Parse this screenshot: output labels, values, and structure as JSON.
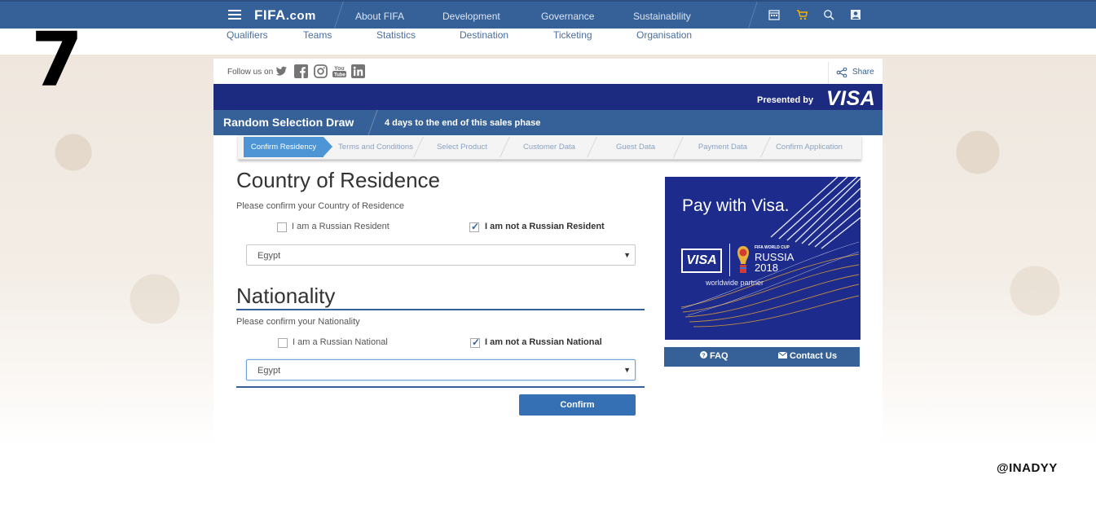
{
  "header": {
    "logo_main": "FIFA",
    "logo_suffix": ".com",
    "nav": [
      "About FIFA",
      "Development",
      "Governance",
      "Sustainability"
    ],
    "icons": [
      "calendar-icon",
      "cart-icon",
      "search-icon",
      "user-icon"
    ],
    "subnav": [
      "Qualifiers",
      "Teams",
      "Statistics",
      "Destination",
      "Ticketing",
      "Organisation"
    ]
  },
  "overlay": {
    "number": "7",
    "watermark": "@INADYY"
  },
  "social": {
    "follow_label": "Follow us on",
    "icons": [
      "twitter-icon",
      "facebook-icon",
      "instagram-icon",
      "youtube-icon",
      "linkedin-icon"
    ],
    "share_label": "Share"
  },
  "sponsor": {
    "presented_label": "Presented by",
    "brand": "VISA"
  },
  "draw": {
    "title": "Random Selection Draw",
    "note": "4 days to the end of this sales phase"
  },
  "steps": [
    {
      "label": "Confirm Residency",
      "active": true
    },
    {
      "label": "Terms and Conditions",
      "active": false
    },
    {
      "label": "Select Product",
      "active": false
    },
    {
      "label": "Customer Data",
      "active": false
    },
    {
      "label": "Guest Data",
      "active": false
    },
    {
      "label": "Payment Data",
      "active": false
    },
    {
      "label": "Confirm Application",
      "active": false
    }
  ],
  "residence": {
    "title": "Country of Residence",
    "subtitle": "Please confirm your Country of Residence",
    "option_yes": "I am a Russian Resident",
    "option_no": "I am not a Russian Resident",
    "selected_option": "no",
    "country": "Egypt"
  },
  "nationality": {
    "title": "Nationality",
    "subtitle": "Please confirm your Nationality",
    "option_yes": "I am a Russian National",
    "option_no": "I am not a Russian National",
    "selected_option": "no",
    "country": "Egypt"
  },
  "actions": {
    "confirm_label": "Confirm"
  },
  "ad": {
    "headline": "Pay with Visa.",
    "brand": "VISA",
    "event_small": "FIFA WORLD CUP",
    "event_name": "RUSSIA",
    "event_year": "2018",
    "tagline": "worldwide partner"
  },
  "help": {
    "faq_label": "FAQ",
    "contact_label": "Contact Us"
  },
  "colors": {
    "nav_blue": "#356098",
    "sponsor_navy": "#1c2a80",
    "active_step": "#4d95d4"
  }
}
